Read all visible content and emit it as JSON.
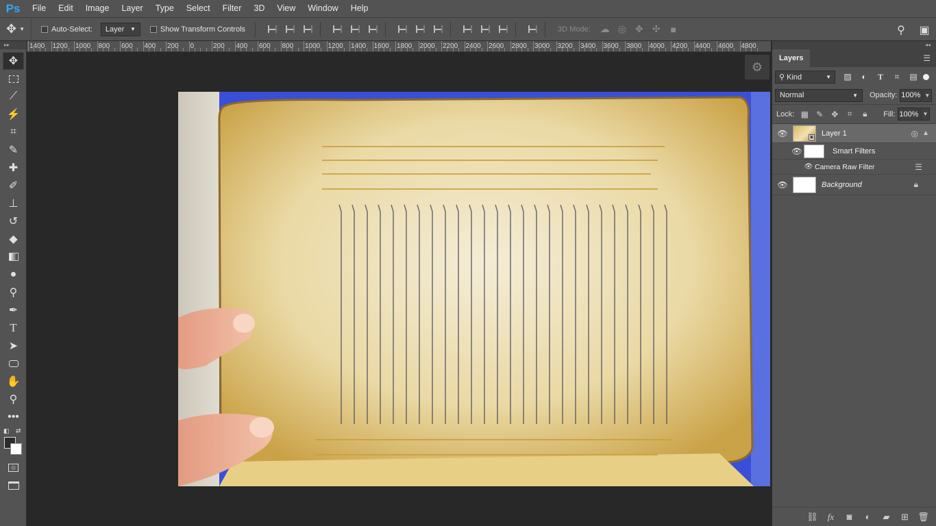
{
  "app": {
    "logo": "Ps"
  },
  "menu": [
    "File",
    "Edit",
    "Image",
    "Layer",
    "Type",
    "Select",
    "Filter",
    "3D",
    "View",
    "Window",
    "Help"
  ],
  "options": {
    "auto_select_label": "Auto-Select:",
    "auto_select_value": "Layer",
    "show_transform_label": "Show Transform Controls",
    "mode_3d_label": "3D Mode:"
  },
  "ruler": {
    "labels": [
      "1400",
      "1200",
      "1000",
      "800",
      "600",
      "400",
      "200",
      "0",
      "200",
      "400",
      "600",
      "800",
      "1000",
      "1200",
      "1400",
      "1600",
      "1800",
      "2000",
      "2200",
      "2400",
      "2600",
      "2800",
      "3000",
      "3200",
      "3400",
      "3600",
      "3800",
      "4000",
      "4200",
      "4400",
      "4600",
      "4800"
    ]
  },
  "image_content": {
    "description": "Photograph of an aged manuscript page with faded Greek script, held open by fingers, against a blue background"
  },
  "layers_panel": {
    "tab_label": "Layers",
    "filter_kind": "Kind",
    "blend_mode": "Normal",
    "opacity_label": "Opacity:",
    "opacity_value": "100%",
    "lock_label": "Lock:",
    "fill_label": "Fill:",
    "fill_value": "100%",
    "layers": [
      {
        "name": "Layer 1",
        "selected": true
      },
      {
        "name": "Smart Filters"
      },
      {
        "name": "Camera Raw Filter"
      },
      {
        "name": "Background",
        "locked": true
      }
    ]
  },
  "colors": {
    "ui_bg": "#535353",
    "canvas_bg": "#282828",
    "accent": "#31a8ff",
    "foreground_color": "#2b2b2b",
    "background_color": "#ffffff"
  }
}
